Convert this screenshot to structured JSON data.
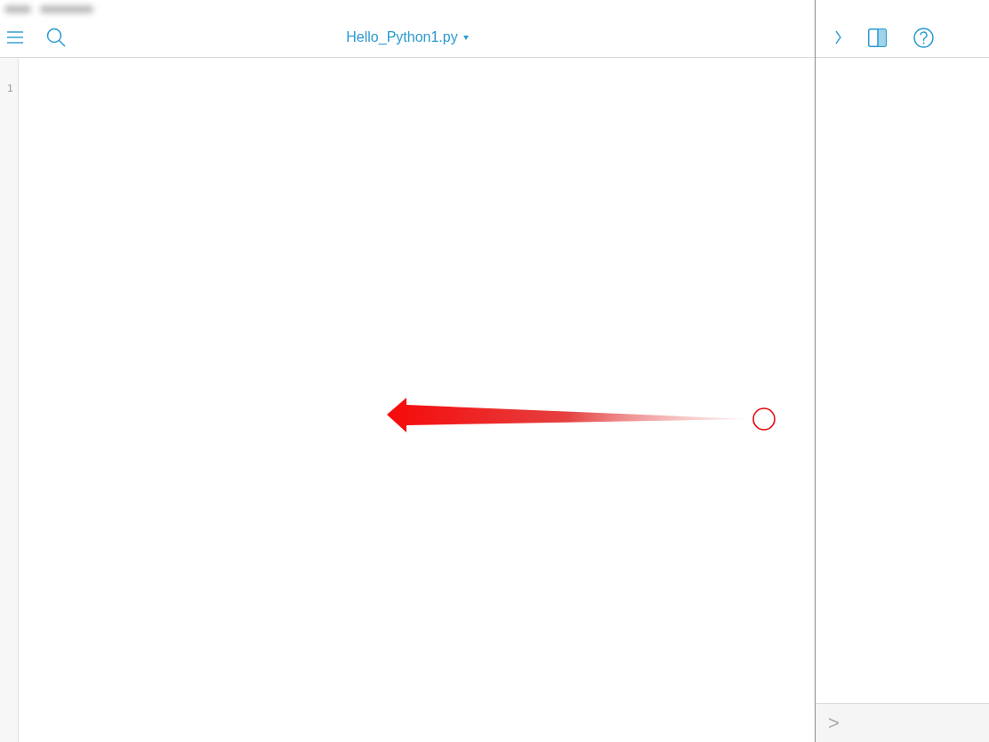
{
  "editor": {
    "title": "Hello_Python1.py",
    "line_numbers": [
      "1"
    ]
  },
  "console": {
    "prompt": ">"
  }
}
